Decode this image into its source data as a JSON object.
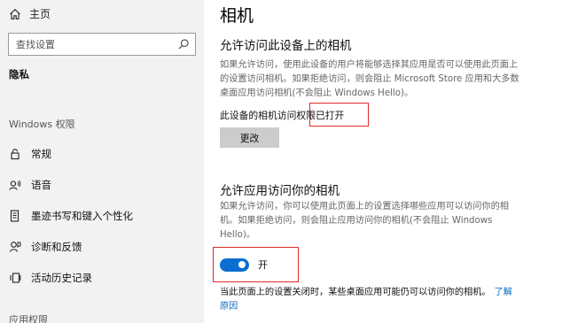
{
  "sidebar": {
    "home_label": "主页",
    "search_placeholder": "查找设置",
    "privacy_label": "隐私",
    "windows_perms_label": "Windows 权限",
    "items": [
      {
        "label": "常规",
        "icon": "lock-icon"
      },
      {
        "label": "语音",
        "icon": "voice-icon"
      },
      {
        "label": "墨迹书写和键入个性化",
        "icon": "ink-typing-icon"
      },
      {
        "label": "诊断和反馈",
        "icon": "diagnostics-icon"
      },
      {
        "label": "活动历史记录",
        "icon": "activity-history-icon"
      }
    ],
    "app_perms_label": "应用权限"
  },
  "main": {
    "title": "相机",
    "device_section": {
      "heading": "允许访问此设备上的相机",
      "description": "如果允许访问，使用此设备的用户将能够选择其应用是否可以使用此页面上的设置访问相机。如果拒绝访问，则会阻止 Microsoft Store 应用和大多数桌面应用访问相机(不会阻止 Windows Hello)。",
      "status_prefix": "此设备的相机访问权",
      "status_value": "限已打开",
      "change_button": "更改"
    },
    "app_section": {
      "heading": "允许应用访问你的相机",
      "description": "如果允许访问，你可以使用此页面上的设置选择哪些应用可以访问你的相机。如果拒绝访问，则会阻止应用访问你的相机(不会阻止 Windows Hello)。",
      "toggle_on": true,
      "toggle_label": "开",
      "note": "当此页面上的设置关闭时，某些桌面应用可能仍可以访问你的相机。",
      "learn_more": "了解原因"
    }
  },
  "colors": {
    "sidebar_bg": "#f2f2f2",
    "accent": "#0a6fd1",
    "highlight_box": "#e02a2a",
    "link": "#0b6cc4"
  }
}
